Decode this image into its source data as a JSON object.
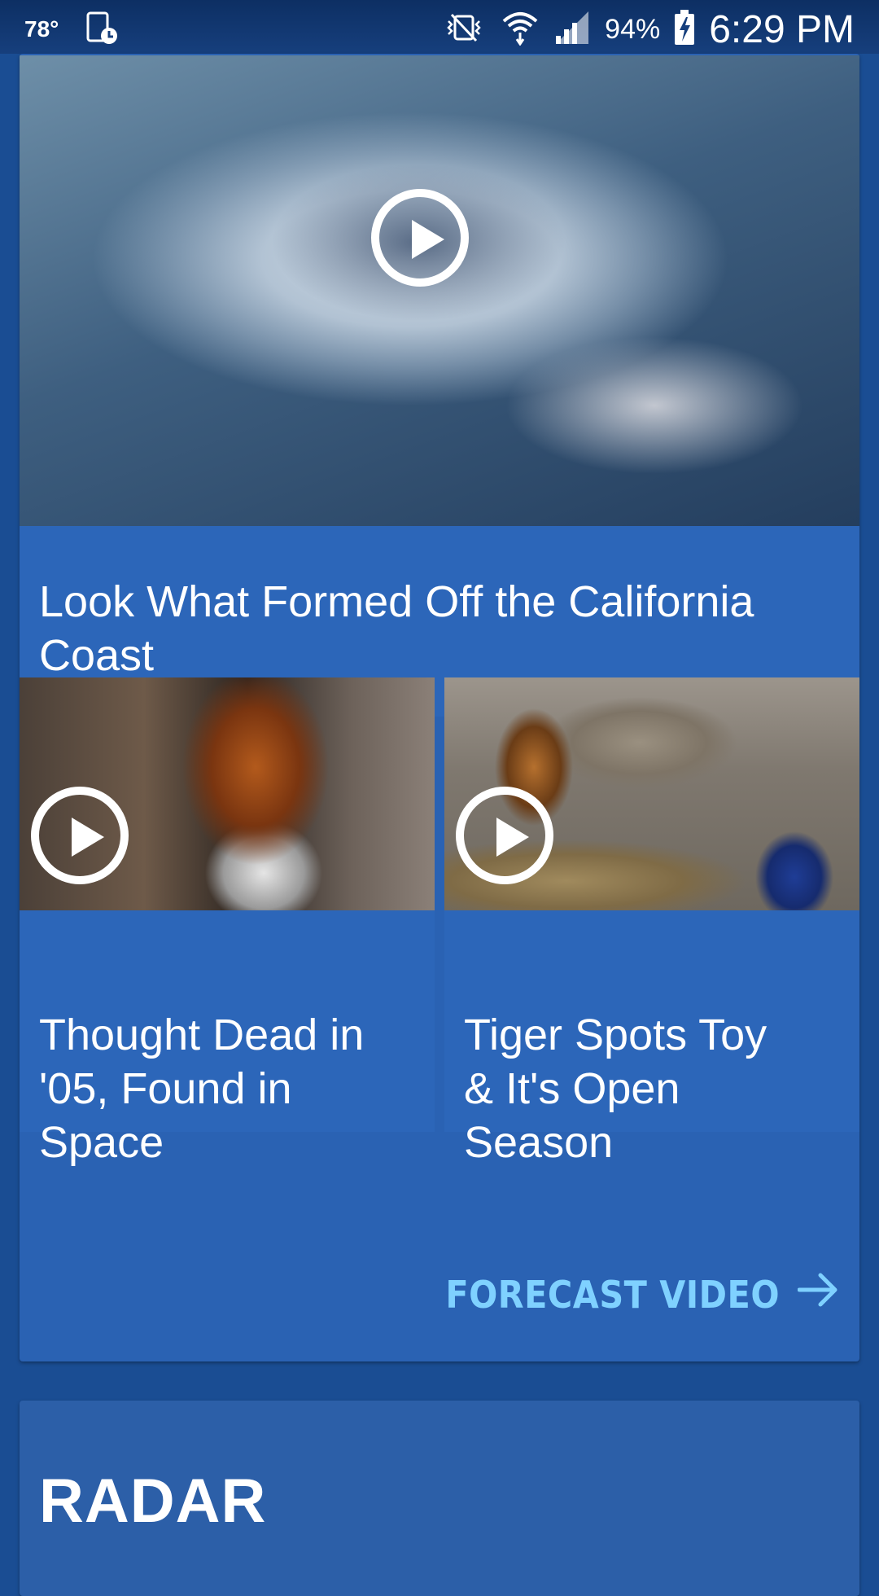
{
  "status_bar": {
    "temperature": "78°",
    "battery_percent": "94%",
    "time": "6:29 PM"
  },
  "featured_video": {
    "title": "Look What Formed Off the California Coast",
    "image_icon": "hurricane-aerial-image"
  },
  "videos": [
    {
      "title": "Thought Dead in '05, Found in Space",
      "image_icon": "satellite-image"
    },
    {
      "title": "Tiger Spots Toy & It's Open Season",
      "image_icon": "tiger-zoo-image"
    }
  ],
  "forecast_link": {
    "label": "FORECAST VIDEO",
    "icon": "arrow-right-icon"
  },
  "radar": {
    "title": "RADAR"
  },
  "colors": {
    "background": "#1a4d93",
    "card": "#2c66b9",
    "accent_link": "#7fd1ff",
    "text": "#ffffff"
  }
}
